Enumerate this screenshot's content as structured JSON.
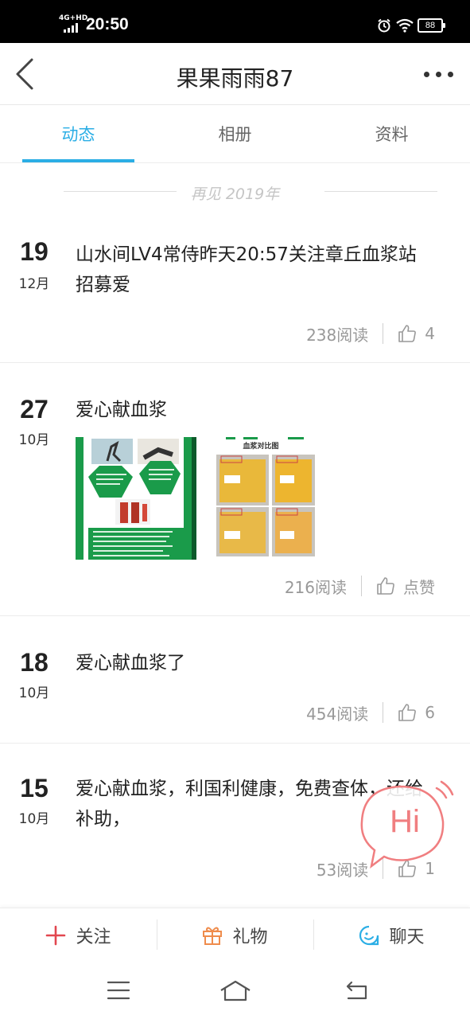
{
  "status_bar": {
    "network": "4G+HD",
    "time": "20:50",
    "battery": "88"
  },
  "header": {
    "title": "果果雨雨87",
    "back_icon": "chevron-left-icon",
    "more_icon": "more-horizontal-icon"
  },
  "tabs": [
    {
      "label": "动态",
      "active": true
    },
    {
      "label": "相册",
      "active": false
    },
    {
      "label": "资料",
      "active": false
    }
  ],
  "year_divider": "再见 2019年",
  "posts": [
    {
      "day": "19",
      "month": "12月",
      "text": "山水间LV4常侍昨天20:57关注章丘血浆站招募爱",
      "reads": "238阅读",
      "likes": "4"
    },
    {
      "day": "27",
      "month": "10月",
      "text": "爱心献血浆",
      "has_images": true,
      "image_b_title": "血浆对比图",
      "reads": "216阅读",
      "likes": "点赞"
    },
    {
      "day": "18",
      "month": "10月",
      "text": "爱心献血浆了",
      "reads": "454阅读",
      "likes": "6"
    },
    {
      "day": "15",
      "month": "10月",
      "text": "爱心献血浆，利国利健康，免费查体，还给补助，",
      "reads": "53阅读",
      "likes": "1"
    }
  ],
  "hi_bubble": {
    "text": "Hi",
    "color": "#f07e80"
  },
  "bottom_bar": [
    {
      "label": "关注",
      "icon": "plus-icon",
      "color": "#e2474f"
    },
    {
      "label": "礼物",
      "icon": "gift-icon",
      "color": "#ef8c4c"
    },
    {
      "label": "聊天",
      "icon": "chat-icon",
      "color": "#2baee5"
    }
  ],
  "accent_color": "#2baee5"
}
